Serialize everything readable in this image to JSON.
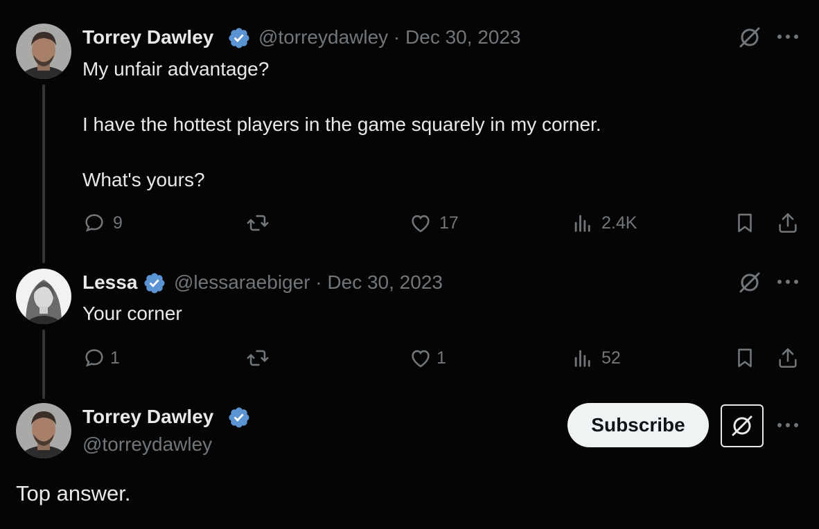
{
  "tweets": [
    {
      "author_name": "Torrey Dawley",
      "handle_date": "@torreydawley · Dec 30, 2023",
      "lines": [
        "My unfair advantage?",
        "I have the hottest players in the game squarely in my corner.",
        "What's yours?"
      ],
      "replies": "9",
      "reposts": "",
      "likes": "17",
      "views": "2.4K"
    },
    {
      "author_name": "Lessa",
      "handle_date": "@lessaraebiger · Dec 30, 2023",
      "lines": [
        "Your corner"
      ],
      "replies": "1",
      "reposts": "",
      "likes": "1",
      "views": "52"
    }
  ],
  "focused": {
    "author_name": "Torrey Dawley",
    "handle": "@torreydawley",
    "subscribe_label": "Subscribe",
    "text": "Top answer."
  },
  "colors": {
    "background": "#050505",
    "text_primary": "#e7e9ea",
    "text_secondary": "#71767b",
    "verified": "#5b93d3",
    "thread_line": "#333639"
  },
  "icons": [
    "verified-badge-icon",
    "grok-icon",
    "more-icon",
    "reply-icon",
    "repost-icon",
    "like-icon",
    "views-icon",
    "bookmark-icon",
    "share-icon"
  ]
}
